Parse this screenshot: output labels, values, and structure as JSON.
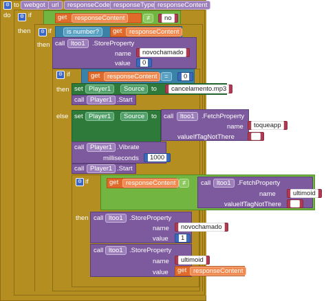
{
  "event": {
    "to": "to",
    "name": "webgot",
    "params": [
      "url",
      "responseCode",
      "responseType",
      "responseContent"
    ],
    "do": "do"
  },
  "kw": {
    "if": "if",
    "then": "then",
    "else": "else",
    "call": "call",
    "set": "set",
    "to": "to",
    "get": "get",
    "name": "name",
    "value": "value",
    "valueIfTagNotThere": "valueIfTagNotThere",
    "milliseconds": "milliseconds",
    "is_number": "is number?"
  },
  "if1": {
    "var": "responseContent",
    "op": "≠",
    "text": "no"
  },
  "if2": {
    "var": "responseContent"
  },
  "store1": {
    "component": "ltoo1",
    "method": ".StoreProperty",
    "name": "novochamado",
    "value": "0"
  },
  "if3": {
    "var": "responseContent",
    "op": "=",
    "value": "0"
  },
  "set1": {
    "component": "Player1",
    "prop": "Source",
    "text": "cancelamento.mp3"
  },
  "call1": {
    "component": "Player1",
    "method": ".Start"
  },
  "set2": {
    "component": "Player1",
    "prop": "Source",
    "fetch_component": "ltoo1",
    "fetch_method": ".FetchProperty",
    "name": "toqueapp",
    "default": ""
  },
  "vibrate": {
    "component": "Player1",
    "method": ".Vibrate",
    "ms": "1000"
  },
  "call2": {
    "component": "Player1",
    "method": ".Start"
  },
  "if4": {
    "var": "responseContent",
    "op": "≠",
    "fetch_component": "ltoo1",
    "fetch_method": ".FetchProperty",
    "name": "ultimoid",
    "default": ""
  },
  "store2": {
    "component": "ltoo1",
    "method": ".StoreProperty",
    "name": "novochamado",
    "value": "1"
  },
  "store3": {
    "component": "ltoo1",
    "method": ".StoreProperty",
    "name": "ultimoid",
    "var": "responseContent"
  },
  "colors": {
    "event": "#b48e20",
    "control": "#b48e20",
    "component": "#7d5a9e",
    "variable": "#e06a2a",
    "math": "#3a6ab8",
    "text": "#b03a52",
    "logic": "#72b540"
  },
  "icons": [
    "gear-icon",
    "dropdown-triangle-icon"
  ]
}
